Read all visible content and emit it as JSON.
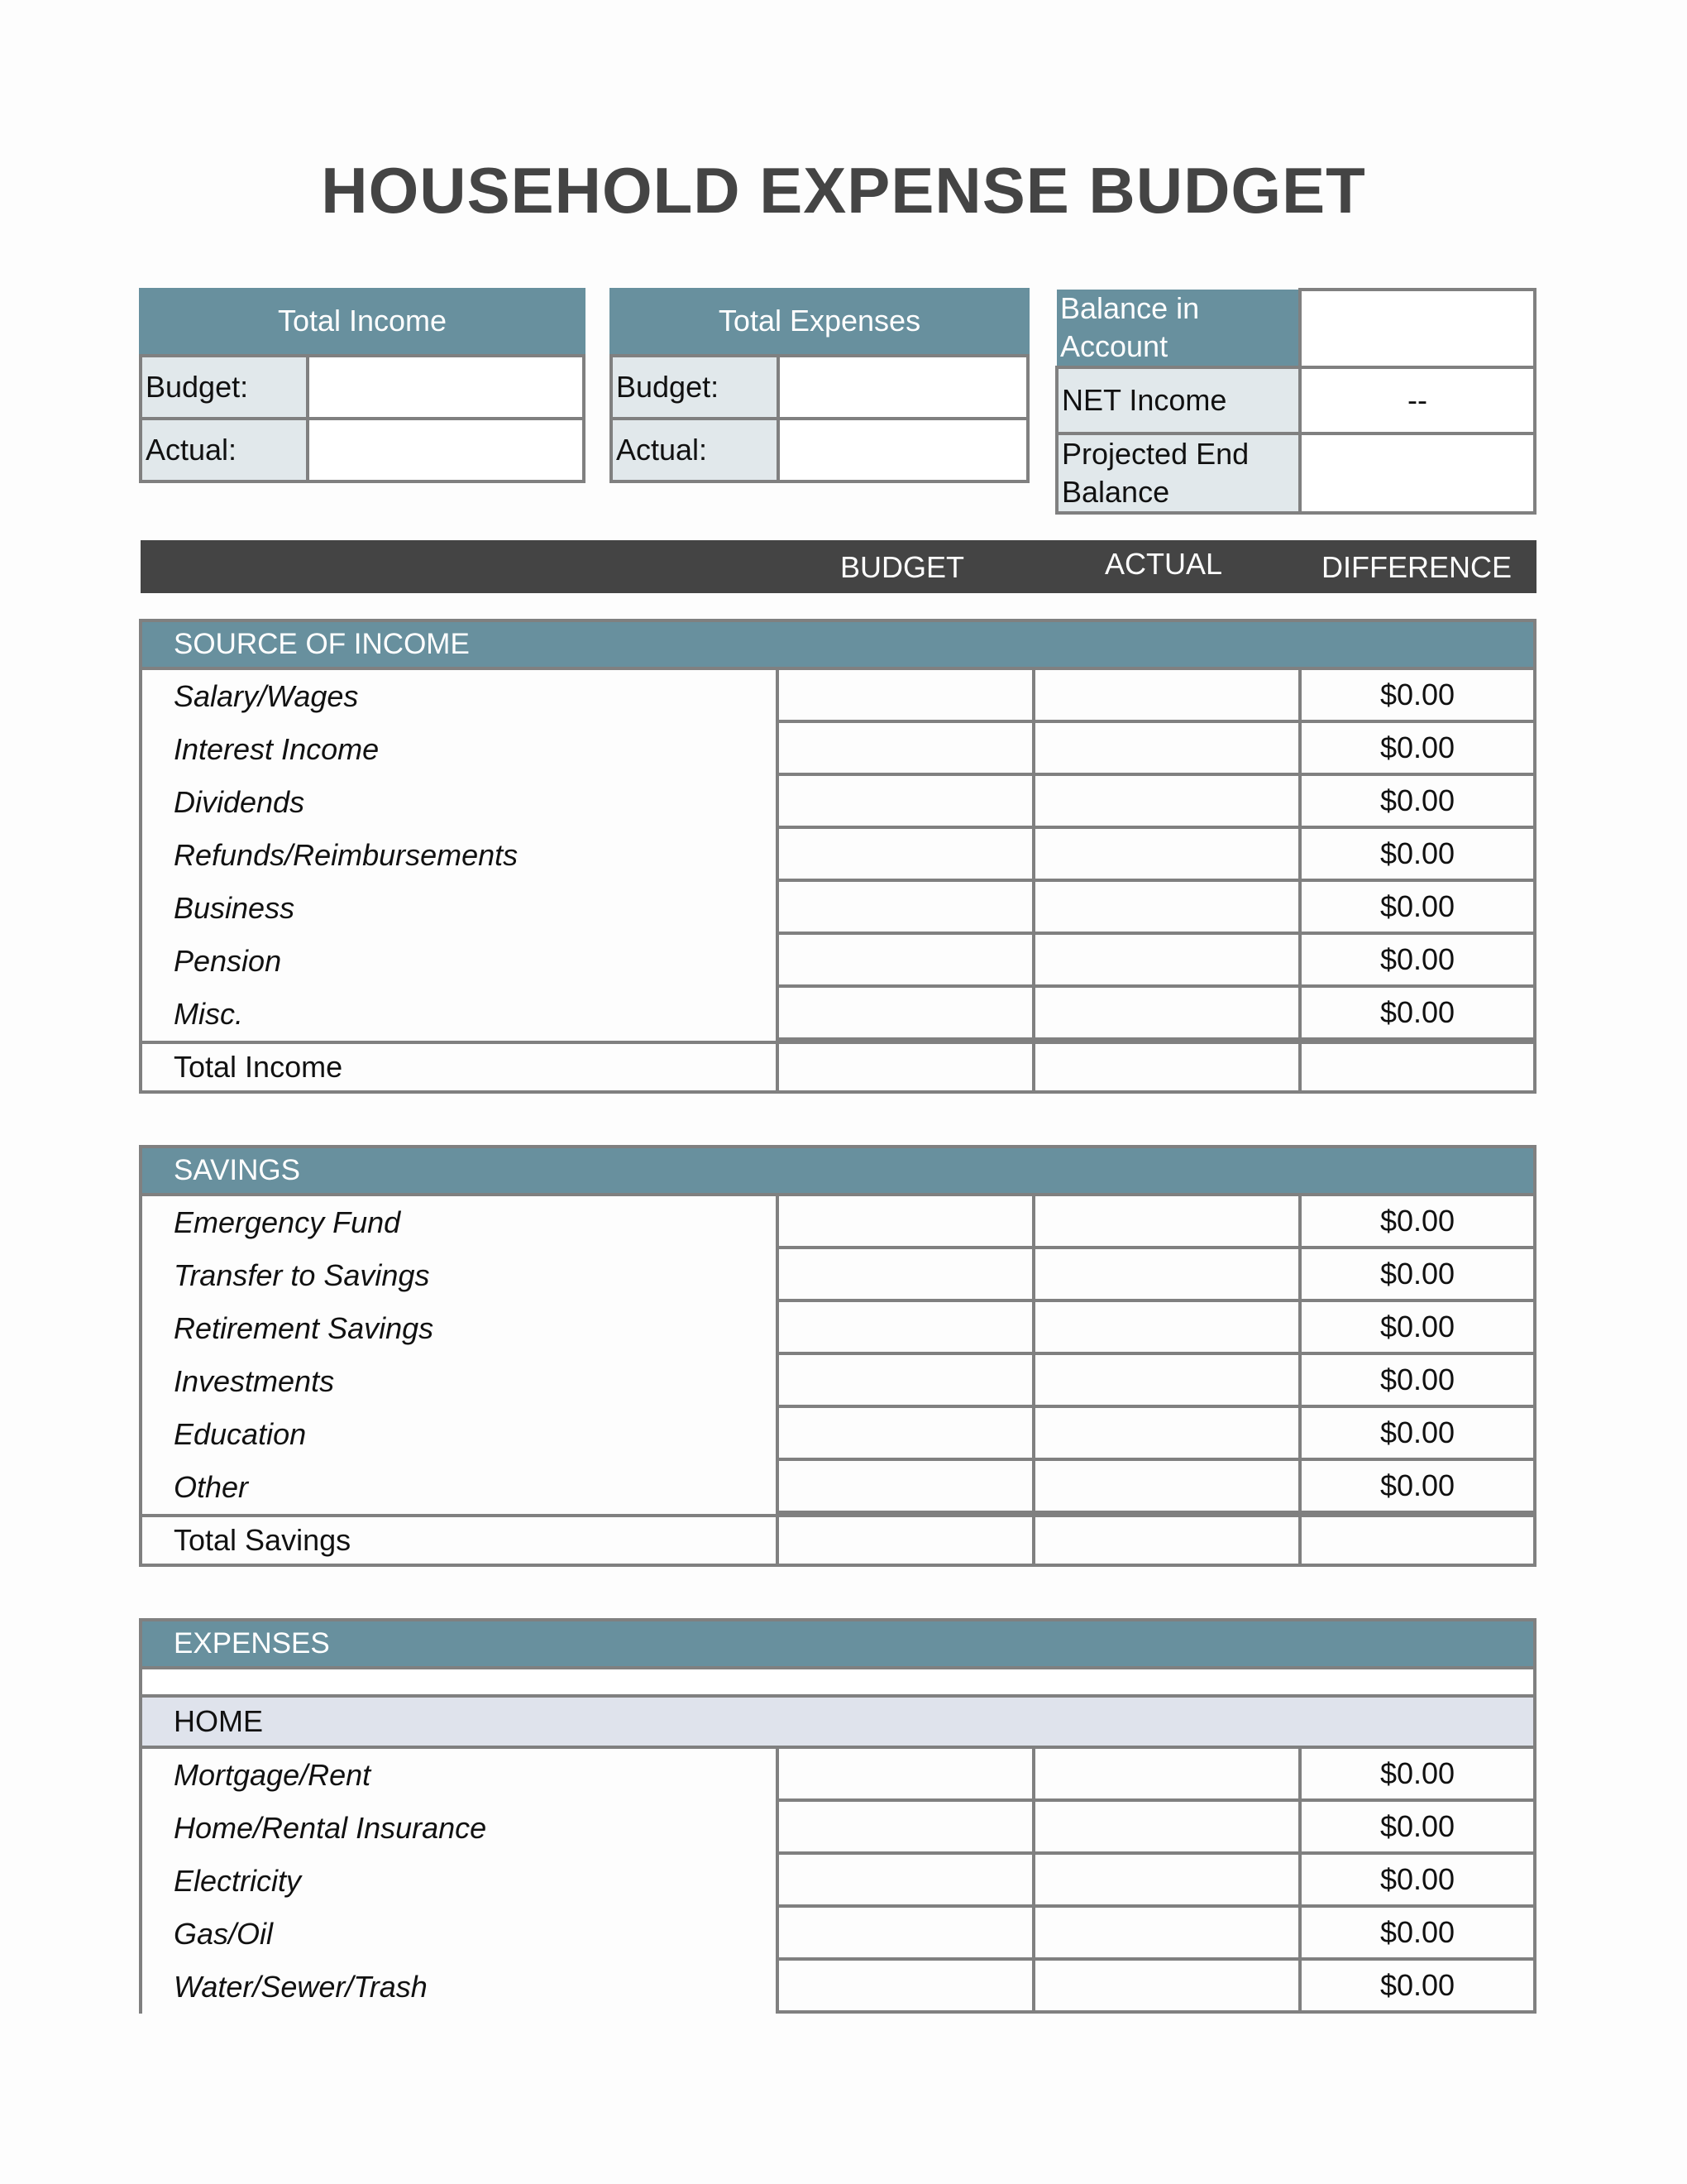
{
  "title": "HOUSEHOLD EXPENSE BUDGET",
  "summary": {
    "total_income": {
      "header": "Total Income",
      "budget_label": "Budget:",
      "budget_value": "",
      "actual_label": "Actual:",
      "actual_value": ""
    },
    "total_expenses": {
      "header": "Total Expenses",
      "budget_label": "Budget:",
      "budget_value": "",
      "actual_label": "Actual:",
      "actual_value": ""
    },
    "balance": {
      "balance_label": "Balance in Account",
      "balance_value": "",
      "net_income_label": "NET Income",
      "net_income_value": "--",
      "projected_label": "Projected End Balance",
      "projected_value": ""
    }
  },
  "columns": {
    "budget": "BUDGET",
    "actual": "ACTUAL",
    "difference": "DIFFERENCE"
  },
  "income": {
    "header": "SOURCE OF INCOME",
    "rows": [
      {
        "label": "Salary/Wages",
        "budget": "",
        "actual": "",
        "difference": "$0.00"
      },
      {
        "label": "Interest Income",
        "budget": "",
        "actual": "",
        "difference": "$0.00"
      },
      {
        "label": "Dividends",
        "budget": "",
        "actual": "",
        "difference": "$0.00"
      },
      {
        "label": "Refunds/Reimbursements",
        "budget": "",
        "actual": "",
        "difference": "$0.00"
      },
      {
        "label": "Business",
        "budget": "",
        "actual": "",
        "difference": "$0.00"
      },
      {
        "label": "Pension",
        "budget": "",
        "actual": "",
        "difference": "$0.00"
      },
      {
        "label": "Misc.",
        "budget": "",
        "actual": "",
        "difference": "$0.00"
      }
    ],
    "total_label": "Total Income"
  },
  "savings": {
    "header": "SAVINGS",
    "rows": [
      {
        "label": "Emergency Fund",
        "budget": "",
        "actual": "",
        "difference": "$0.00"
      },
      {
        "label": "Transfer to Savings",
        "budget": "",
        "actual": "",
        "difference": "$0.00"
      },
      {
        "label": "Retirement Savings",
        "budget": "",
        "actual": "",
        "difference": "$0.00"
      },
      {
        "label": "Investments",
        "budget": "",
        "actual": "",
        "difference": "$0.00"
      },
      {
        "label": "Education",
        "budget": "",
        "actual": "",
        "difference": "$0.00"
      },
      {
        "label": "Other",
        "budget": "",
        "actual": "",
        "difference": "$0.00"
      }
    ],
    "total_label": "Total Savings"
  },
  "expenses": {
    "header": "EXPENSES",
    "subsection": "HOME",
    "rows": [
      {
        "label": "Mortgage/Rent",
        "budget": "",
        "actual": "",
        "difference": "$0.00"
      },
      {
        "label": "Home/Rental Insurance",
        "budget": "",
        "actual": "",
        "difference": "$0.00"
      },
      {
        "label": "Electricity",
        "budget": "",
        "actual": "",
        "difference": "$0.00"
      },
      {
        "label": "Gas/Oil",
        "budget": "",
        "actual": "",
        "difference": "$0.00"
      },
      {
        "label": "Water/Sewer/Trash",
        "budget": "",
        "actual": "",
        "difference": "$0.00"
      }
    ]
  }
}
